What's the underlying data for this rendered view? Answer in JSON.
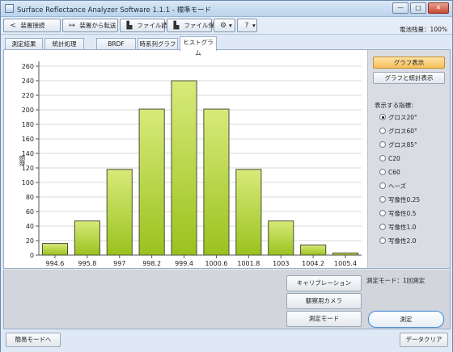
{
  "window": {
    "title": "Surface Reflectance Analyzer Software 1.1.1 - 標準モード",
    "minimize": "—",
    "maximize": "□",
    "close": "✕"
  },
  "toolbar": {
    "connect_label": "装置接続",
    "transfer_label": "装置から転送",
    "read_file_label": "ファイル読込",
    "save_file_label": "ファイル保存",
    "settings_label": "▾",
    "help_label": "▾",
    "battery_text": "電池残量：100%"
  },
  "tabs": [
    {
      "label": "測定結果"
    },
    {
      "label": "統計処理"
    },
    {
      "label": "BRDF"
    },
    {
      "label": "時系列グラフ"
    },
    {
      "label": "ヒストグラム"
    }
  ],
  "side_panel": {
    "graph_button": "グラフ表示",
    "graph_stats_button": "グラフと統計表示",
    "indicator_label": "表示する指標：",
    "options": [
      {
        "label": "グロス20°",
        "selected": true
      },
      {
        "label": "グロス60°",
        "selected": false
      },
      {
        "label": "グロス85°",
        "selected": false
      },
      {
        "label": "C20",
        "selected": false
      },
      {
        "label": "C60",
        "selected": false
      },
      {
        "label": "ヘーズ",
        "selected": false
      },
      {
        "label": "写像性0.25",
        "selected": false
      },
      {
        "label": "写像性0.5",
        "selected": false
      },
      {
        "label": "写像性1.0",
        "selected": false
      },
      {
        "label": "写像性2.0",
        "selected": false
      }
    ]
  },
  "bottom": {
    "calibration_button": "キャリブレーション",
    "camera_button": "観察用カメラ",
    "measure_mode_button": "測定モード",
    "mode_text": "測定モード：1回測定",
    "measure_button": "測定"
  },
  "status": {
    "simple_mode_button": "簡易モードへ",
    "clear_button": "データクリア"
  },
  "chart_data": {
    "type": "bar",
    "categories": [
      "994.6",
      "995.8",
      "997",
      "998.2",
      "999.4",
      "1000.6",
      "1001.8",
      "1003",
      "1004.2",
      "1005.4"
    ],
    "values": [
      16,
      47,
      118,
      201,
      240,
      201,
      118,
      47,
      14,
      3
    ],
    "ylabel": "個数",
    "ylim": [
      0,
      260
    ],
    "yticks": [
      0,
      20,
      40,
      60,
      80,
      100,
      120,
      140,
      160,
      180,
      200,
      220,
      240,
      260
    ],
    "grid": true,
    "bar_color_top": "#d8ea7a",
    "bar_color_bottom": "#9ac21e",
    "bar_border": "#4a4f38"
  }
}
